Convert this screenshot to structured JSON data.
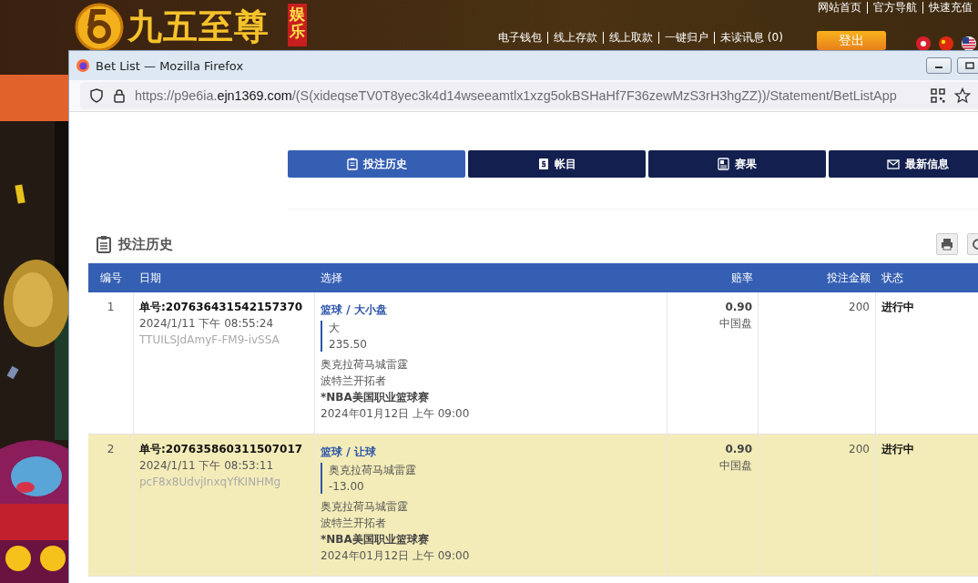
{
  "site": {
    "logo_text": "九五至尊",
    "logo_badge": "娱乐",
    "top_links": [
      "网站首页",
      "官方导航",
      "快速充值"
    ],
    "account_links": [
      "电子钱包",
      "线上存款",
      "线上取款",
      "一键归户",
      "未读讯息 (0)"
    ],
    "logout_button": "登出"
  },
  "browser": {
    "title": "Bet List — Mozilla Firefox",
    "url": [
      {
        "kind": "faint",
        "text": "https://p9e6ia."
      },
      {
        "kind": "host",
        "text": "ejn1369.com"
      },
      {
        "kind": "faint",
        "text": "/(S(xideqseTV0T8yec3k4d14wseeamtlx1xzg5okBSHaHf7F36zewMzS3rH3hgZZ))/Statement/BetListApp"
      }
    ]
  },
  "tabs": [
    {
      "label": "投注历史",
      "selected": true,
      "kind": "clipboard"
    },
    {
      "label": "帐目",
      "selected": false,
      "kind": "ledger"
    },
    {
      "label": "赛果",
      "selected": false,
      "kind": "results"
    },
    {
      "label": "最新信息",
      "selected": false,
      "kind": "mail"
    }
  ],
  "section_title": "投注历史",
  "table": {
    "columns": [
      "编号",
      "日期",
      "选择",
      "赔率",
      "投注金额",
      "状态"
    ],
    "rows": [
      {
        "no": "1",
        "ticket": "单号:207636431542157370",
        "placed": "2024/1/11 下午 08:55:24",
        "code": "TTUILSJdAmyF-FM9-ivSSA",
        "market": "篮球 / 大小盘",
        "pick": [
          "大",
          "235.50"
        ],
        "teams": [
          "奥克拉荷马城雷霆",
          "波特兰开拓者"
        ],
        "league": "*NBA美国职业篮球赛",
        "match_time": "2024年01月12日 上午 09:00",
        "odds": "0.90",
        "odds_type": "中国盘",
        "stake": "200",
        "status": "进行中",
        "selected": false
      },
      {
        "no": "2",
        "ticket": "单号:207635860311507017",
        "placed": "2024/1/11 下午 08:53:11",
        "code": "pcF8x8UdvjInxqYfKINHMg",
        "market": "篮球 / 让球",
        "pick": [
          "奥克拉荷马城雷霆",
          "-13.00"
        ],
        "teams": [
          "奥克拉荷马城雷霆",
          "波特兰开拓者"
        ],
        "league": "*NBA美国职业篮球赛",
        "match_time": "2024年01月12日 上午 09:00",
        "odds": "0.90",
        "odds_type": "中国盘",
        "stake": "200",
        "status": "进行中",
        "selected": true
      }
    ]
  }
}
